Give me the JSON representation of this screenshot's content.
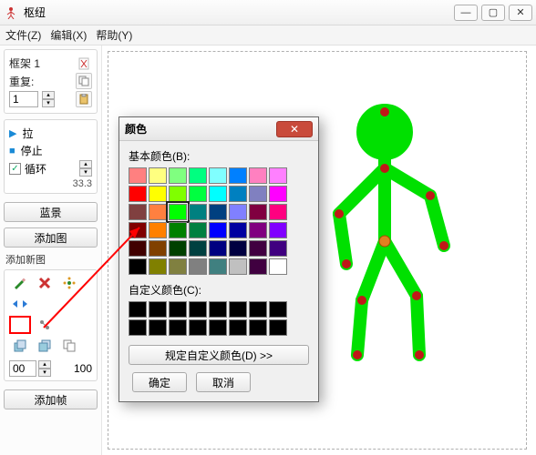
{
  "window": {
    "title": "枢纽",
    "buttons": {
      "min": "—",
      "max": "▢",
      "close": "✕"
    }
  },
  "menu": {
    "file": "文件(Z)",
    "edit": "编辑(X)",
    "help": "帮助(Y)"
  },
  "frames": {
    "label": "框架 1",
    "repeat_label": "重复:",
    "repeat_value": "1"
  },
  "playback": {
    "play": "拉",
    "stop": "停止",
    "loop": "循环",
    "fps": "33.3"
  },
  "buttons": {
    "background": "蓝景",
    "add_image": "添加图",
    "add_frame": "添加帧"
  },
  "figure": {
    "section": "添加新图",
    "alpha": "00",
    "scale": "100"
  },
  "dialog": {
    "title": "颜色",
    "basic_label": "基本颜色(B):",
    "custom_label": "自定义颜色(C):",
    "define": "规定自定义颜色(D) >>",
    "ok": "确定",
    "cancel": "取消",
    "basic_colors": [
      "#ff8080",
      "#ffff80",
      "#80ff80",
      "#00ff80",
      "#80ffff",
      "#0080ff",
      "#ff80c0",
      "#ff80ff",
      "#ff0000",
      "#ffff00",
      "#80ff00",
      "#00ff40",
      "#00ffff",
      "#0080c0",
      "#8080c0",
      "#ff00ff",
      "#804040",
      "#ff8040",
      "#00ff00",
      "#008080",
      "#004080",
      "#8080ff",
      "#800040",
      "#ff0080",
      "#800000",
      "#ff8000",
      "#008000",
      "#008040",
      "#0000ff",
      "#0000a0",
      "#800080",
      "#8000ff",
      "#400000",
      "#804000",
      "#004000",
      "#004040",
      "#000080",
      "#000040",
      "#400040",
      "#400080",
      "#000000",
      "#808000",
      "#808040",
      "#808080",
      "#408080",
      "#c0c0c0",
      "#400040",
      "#ffffff"
    ],
    "selected_index": 18
  }
}
